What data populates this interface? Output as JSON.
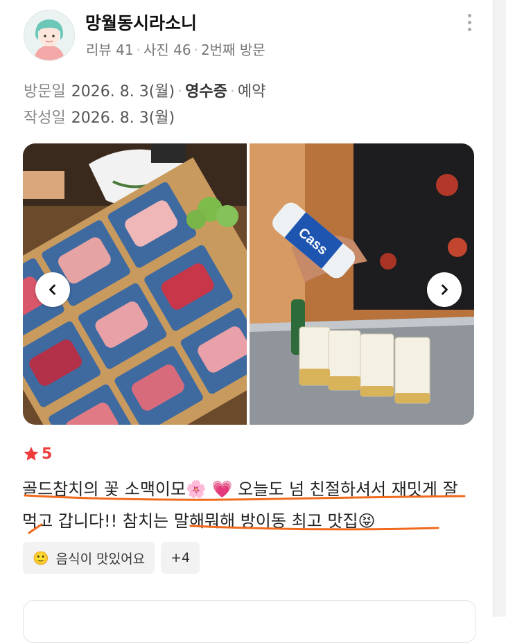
{
  "user": {
    "name": "망월동시라소니",
    "reviews_label": "리뷰 41",
    "photos_label": "사진 46",
    "visit_count_label": "2번째 방문"
  },
  "visit": {
    "label": "방문일",
    "date": "2026. 8. 3(월)",
    "receipt_label": "영수증",
    "reservation_label": "예약"
  },
  "written": {
    "label": "작성일",
    "date": "2026. 8. 3(월)"
  },
  "rating": {
    "value": "5",
    "color": "#ee3b3b"
  },
  "review": {
    "text_part1": "골드참치의 꽃 소맥이모",
    "emoji1": "🌸",
    "emoji2": "💗",
    "text_part2": " 오늘도 넘 친절하셔서 재밋게 잘 먹고 갑니다!! 참치는 말해뭐해 방이동 최고 맛집",
    "emoji3": "😝",
    "underline_color": "#f06a1d"
  },
  "tags": {
    "first_emoji": "🙂",
    "first_label": "음식이 맛있어요",
    "more_label": "+4"
  },
  "icons": {
    "more": "more-vertical-icon",
    "prev": "chevron-left-icon",
    "next": "chevron-right-icon",
    "star": "star-icon"
  }
}
